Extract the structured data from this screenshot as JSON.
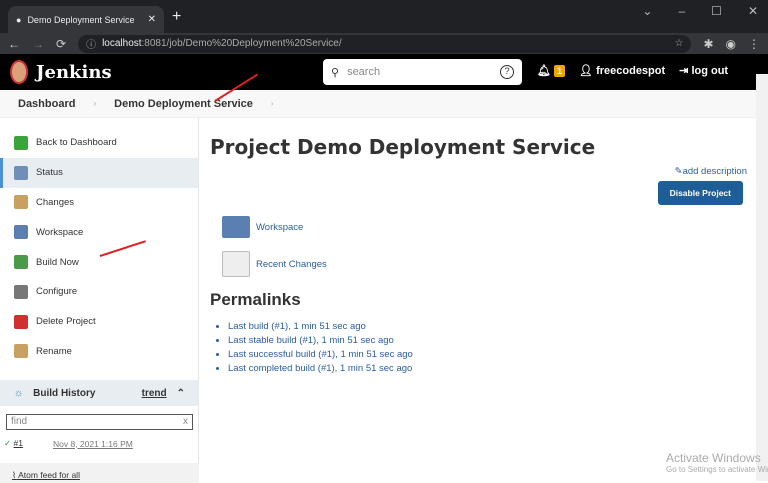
{
  "browser": {
    "tab_title": "Demo Deployment Service [Jenkins]",
    "url_host": "localhost",
    "url_path": ":8081/job/Demo%20Deployment%20Service/"
  },
  "header": {
    "logo": "Jenkins",
    "search_placeholder": "search",
    "notifications": "1",
    "user": "freecodespot",
    "logout": "log out"
  },
  "breadcrumbs": [
    "Dashboard",
    "Demo Deployment Service"
  ],
  "sidebar": {
    "items": [
      {
        "label": "Back to Dashboard",
        "color": "#3aa33a"
      },
      {
        "label": "Status",
        "color": "#6f8fb8"
      },
      {
        "label": "Changes",
        "color": "#c8a060"
      },
      {
        "label": "Workspace",
        "color": "#5a7fb0"
      },
      {
        "label": "Build Now",
        "color": "#4a9a4a"
      },
      {
        "label": "Configure",
        "color": "#777777"
      },
      {
        "label": "Delete Project",
        "color": "#d03030"
      },
      {
        "label": "Rename",
        "color": "#c8a060"
      }
    ]
  },
  "build_history": {
    "title": "Build History",
    "trend": "trend",
    "find_placeholder": "find",
    "clear": "x",
    "builds": [
      {
        "number": "#1",
        "date": "Nov 8, 2021 1:16 PM"
      }
    ],
    "feed": "Atom feed for all"
  },
  "main": {
    "title": "Project Demo Deployment Service",
    "add_description": "add description",
    "disable_button": "Disable Project",
    "links": [
      "Workspace",
      "Recent Changes"
    ],
    "permalinks_title": "Permalinks",
    "permalinks": [
      "Last build (#1), 1 min 51 sec ago",
      "Last stable build (#1), 1 min 51 sec ago",
      "Last successful build (#1), 1 min 51 sec ago",
      "Last completed build (#1), 1 min 51 sec ago"
    ]
  },
  "watermark": {
    "title": "Activate Windows",
    "sub": "Go to Settings to activate Windows."
  }
}
